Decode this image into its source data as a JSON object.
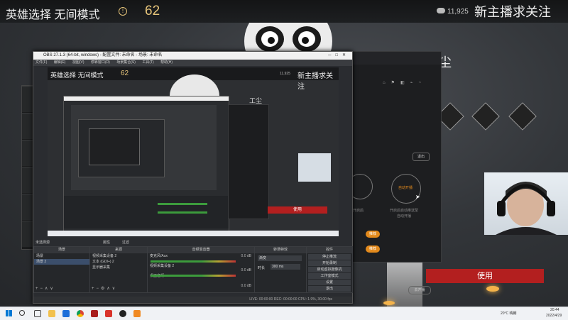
{
  "game": {
    "header_title": "英雄选择 无间模式",
    "count": "62",
    "coins": "11,925",
    "follow_banner": "新主播求关注",
    "name_partial": "工尘",
    "use_button": "使用"
  },
  "obs": {
    "window_title": "OBS 27.1.3 (64-bit, windows) - 配置文件: 未命名 - 场景: 未命名",
    "menu": [
      "文件(F)",
      "编辑(E)",
      "视图(V)",
      "停靠窗口(D)",
      "场景集合(S)",
      "工具(T)",
      "帮助(H)"
    ],
    "preview": {
      "header_title": "英雄选择 无间模式",
      "count": "62",
      "coins": "11,925",
      "follow_banner": "新主播求关注",
      "name_partial": "工尘",
      "use_button": "使用"
    },
    "source_tabs": [
      "属性",
      "过滤"
    ],
    "no_source": "未选择源",
    "docks": {
      "scenes": {
        "title": "场景",
        "items": [
          "场景",
          "场景 2"
        ]
      },
      "sources": {
        "title": "来源",
        "items": [
          "视频采集设备 2",
          "文本 (GDI+) 2",
          "显示器采集"
        ]
      },
      "mixer": {
        "title": "音频混音器",
        "channels": [
          {
            "name": "麦克风/Aux",
            "level": "0.0 dB"
          },
          {
            "name": "视频采集设备 2",
            "level": "0.0 dB"
          },
          {
            "name": "桌面音频",
            "level": "0.0 dB"
          }
        ]
      },
      "transitions": {
        "title": "转场特效",
        "type": "渐变",
        "duration_label": "时长",
        "duration_value": "300 ms"
      },
      "controls": {
        "title": "控件",
        "buttons": [
          "停止推流",
          "开始录制",
          "启动虚拟摄像机",
          "工作室模式",
          "设置",
          "退出"
        ]
      }
    },
    "status_bar": "LIVE: 00:00:00   REC: 00:00:00   CPU: 1.9%, 30.00 fps"
  },
  "panel": {
    "exit_label": "退出",
    "mode_label": "自动开播",
    "hint_left": "开启后",
    "hint_right": "开启后自动推送至",
    "sub_hint": "自动开播",
    "bottom_button": "去开播",
    "item_1": "推荐",
    "item_2": "推荐"
  },
  "taskbar": {
    "weather": "20°C 晴朗",
    "time": "20:44",
    "date": "2022/4/29"
  },
  "colors": {
    "accent_orange": "#e38a1c",
    "use_red": "#b31f1f",
    "gold": "#e6c47a"
  }
}
